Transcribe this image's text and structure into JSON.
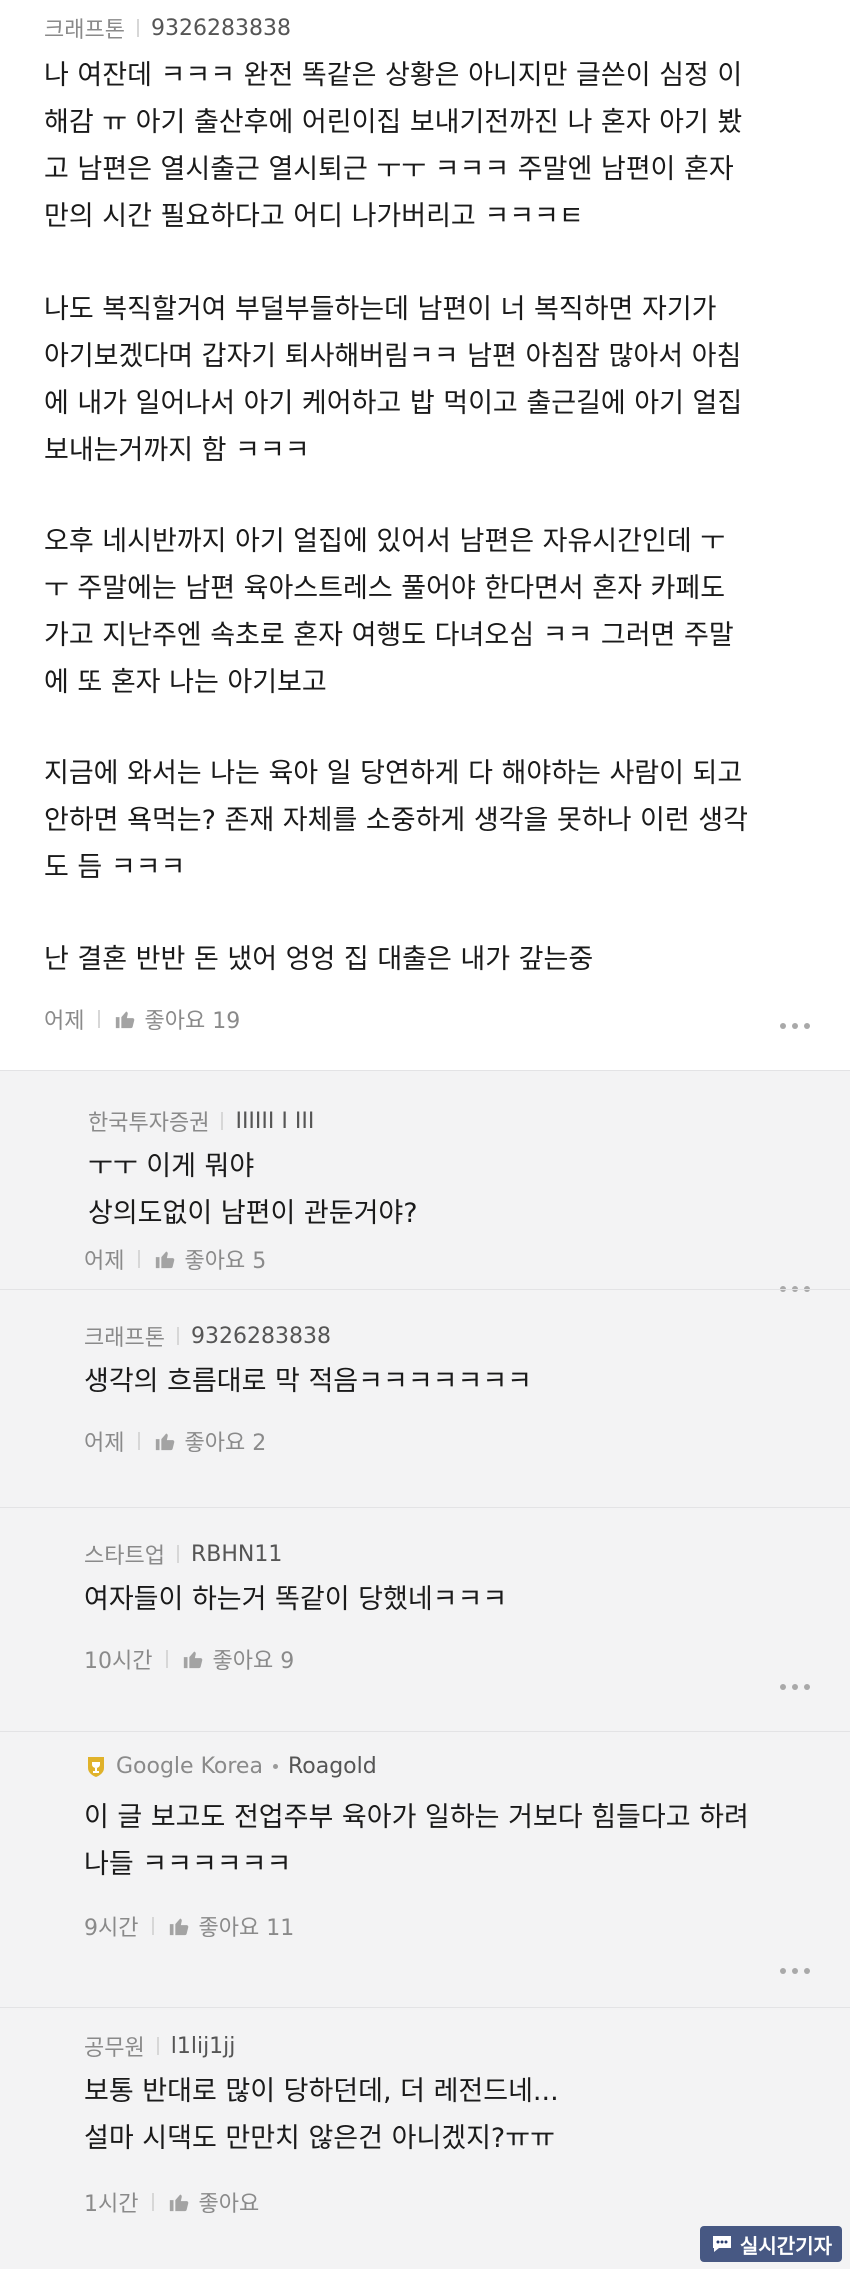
{
  "main_comment": {
    "company": "크래프톤",
    "nickname": "9326283838",
    "paragraphs": [
      "나 여잔데 ㅋㅋㅋ 완전 똑같은 상황은 아니지만 글쓴이 심정 이\n해감 ㅠ 아기 출산후에 어린이집 보내기전까진 나 혼자 아기 봤\n고 남편은 열시출근 열시퇴근 ㅜㅜ ㅋㅋㅋ 주말엔 남편이 혼자\n만의 시간 필요하다고 어디 나가버리고 ㅋㅋㅋㅌ",
      "나도 복직할거여 부덜부들하는데 남편이 너 복직하면 자기가\n아기보겠다며 갑자기 퇴사해버림ㅋㅋ 남편 아침잠 많아서 아침\n에 내가 일어나서 아기 케어하고 밥 먹이고 출근길에 아기 얼집\n보내는거까지 함 ㅋㅋㅋ",
      "오후 네시반까지 아기 얼집에 있어서 남편은 자유시간인데 ㅜ\nㅜ 주말에는 남편 육아스트레스 풀어야 한다면서 혼자 카페도\n가고 지난주엔 속초로 혼자 여행도 다녀오심 ㅋㅋ 그러면 주말\n에 또 혼자 나는 아기보고",
      "지금에 와서는 나는 육아 일 당연하게 다 해야하는 사람이 되고\n안하면 욕먹는? 존재 자체를 소중하게 생각을 못하나 이런 생각\n도 듬 ㅋㅋㅋ",
      "난 결혼 반반 돈 냈어 엉엉 집 대출은 내가 갚는중"
    ],
    "time": "어제",
    "likes": "좋아요 19"
  },
  "replies": [
    {
      "company": "한국투자증권",
      "nickname": "IIIIII I III",
      "text": "ㅜㅜ 이게 뭐야\n상의도없이 남편이 관둔거야?",
      "time": "어제",
      "likes": "좋아요 5",
      "verified": false
    },
    {
      "company": "크래프톤",
      "nickname": "9326283838",
      "text": "생각의 흐름대로 막 적음ㅋㅋㅋㅋㅋㅋㅋ",
      "time": "어제",
      "likes": "좋아요 2",
      "verified": false
    },
    {
      "company": "스타트업",
      "nickname": "RBHN11",
      "text": "여자들이 하는거 똑같이 당했네ㅋㅋㅋ",
      "time": "10시간",
      "likes": "좋아요 9",
      "verified": false
    },
    {
      "company": "Google Korea",
      "nickname": "Roagold",
      "text": "이 글 보고도 전업주부 육아가 일하는 거보다 힘들다고 하려\n나들 ㅋㅋㅋㅋㅋㅋ",
      "time": "9시간",
      "likes": "좋아요 11",
      "verified": true
    },
    {
      "company": "공무원",
      "nickname": "l1lij1jj",
      "text": "보통 반대로 많이 당하던데, 더 레전드네...\n설마 시댁도 만만치 않은건 아니겠지?ㅠㅠ",
      "time": "1시간",
      "likes": "좋아요",
      "verified": false
    }
  ],
  "watermark": {
    "text": "실시간기자"
  },
  "colors": {
    "reply_bg": "#f3f3f4",
    "badge": "#e0b22a",
    "muted": "#8a8a8a"
  }
}
